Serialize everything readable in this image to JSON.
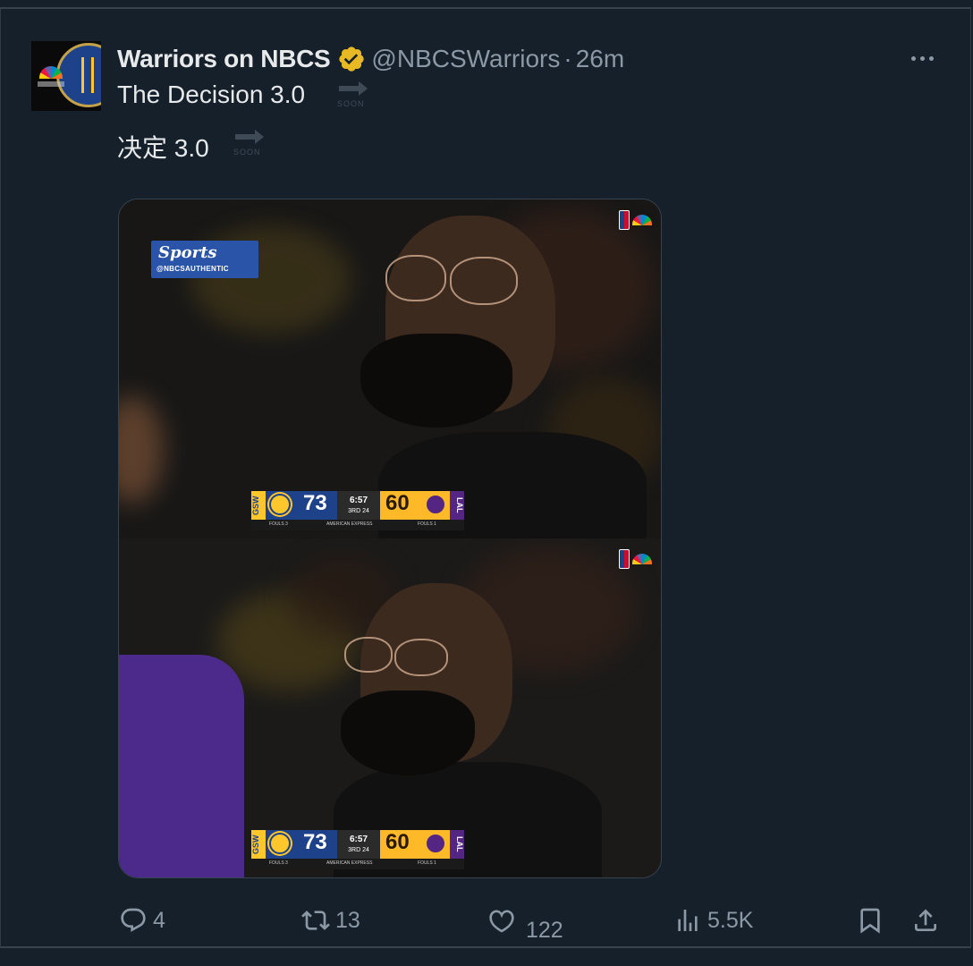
{
  "tweet": {
    "display_name": "Warriors on NBCS",
    "handle": "@NBCSWarriors",
    "separator": "·",
    "time": "26m",
    "text_line_1": "The Decision 3.0",
    "text_line_2": "决定 3.0",
    "soon_label": "SOON",
    "avatar_icon": "nbc-sports-bay-area-warriors-logo",
    "verified_icon": "gold-verified-badge",
    "more_icon": "more-dots-icon"
  },
  "media": {
    "watermark_main": "Sports",
    "watermark_sub": "@NBCSAUTHENTIC",
    "scorebug": {
      "home_tag": "GSW",
      "home_score": "73",
      "clock": "6:57",
      "period": "3RD 24",
      "away_score": "60",
      "away_tag": "LAL",
      "sponsor": "AMERICAN EXPRESS",
      "home_fouls": "FOULS 3",
      "away_fouls": "FOULS 1"
    }
  },
  "actions": {
    "reply_count": "4",
    "retweet_count": "13",
    "like_count": "122",
    "views_count": "5.5K"
  },
  "colors": {
    "background": "#15202b",
    "text_primary": "#e7e9ea",
    "text_secondary": "#8b98a5",
    "verified": "#e8b923",
    "border": "#38444d"
  }
}
